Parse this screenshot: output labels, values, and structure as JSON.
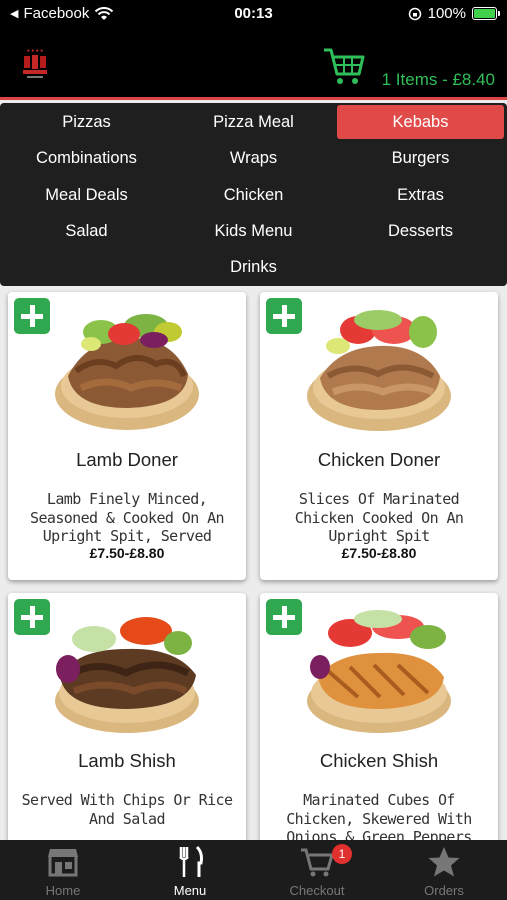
{
  "status_bar": {
    "back_app": "Facebook",
    "time": "00:13",
    "battery_percent": "100%",
    "battery_level": 1.0
  },
  "header": {
    "cart_summary": "1 Items - £8.40",
    "accent_color": "#2fbf5a"
  },
  "categories": {
    "items": [
      {
        "label": "Pizzas",
        "active": false
      },
      {
        "label": "Pizza Meal",
        "active": false
      },
      {
        "label": "Kebabs",
        "active": true
      },
      {
        "label": "Combinations",
        "active": false
      },
      {
        "label": "Wraps",
        "active": false
      },
      {
        "label": "Burgers",
        "active": false
      },
      {
        "label": "Meal Deals",
        "active": false
      },
      {
        "label": "Chicken",
        "active": false
      },
      {
        "label": "Extras",
        "active": false
      },
      {
        "label": "Salad",
        "active": false
      },
      {
        "label": "Kids Menu",
        "active": false
      },
      {
        "label": "Desserts",
        "active": false
      },
      {
        "label": "Drinks",
        "active": false
      }
    ],
    "active_color": "#e04a48"
  },
  "products": [
    {
      "name": "Lamb Doner",
      "description": "Lamb Finely Minced, Seasoned & Cooked On An Upright Spit, Served",
      "price": "£7.50-£8.80",
      "image_icon": "lamb-doner-image"
    },
    {
      "name": "Chicken Doner",
      "description": "Slices Of Marinated Chicken Cooked On An Upright Spit",
      "price": "£7.50-£8.80",
      "image_icon": "chicken-doner-image"
    },
    {
      "name": "Lamb Shish",
      "description": "Served With Chips Or Rice And Salad",
      "price": "",
      "image_icon": "lamb-shish-image"
    },
    {
      "name": "Chicken Shish",
      "description": "Marinated Cubes Of Chicken, Skewered With Onions & Green Peppers",
      "price": "",
      "image_icon": "chicken-shish-image"
    }
  ],
  "tabbar": {
    "tabs": [
      {
        "label": "Home",
        "icon": "store-icon",
        "active": false
      },
      {
        "label": "Menu",
        "icon": "fork-knife-icon",
        "active": true
      },
      {
        "label": "Checkout",
        "icon": "cart-icon",
        "active": false
      },
      {
        "label": "Orders",
        "icon": "star-icon",
        "active": false
      }
    ],
    "checkout_badge": "1",
    "badge_color": "#e0312f"
  }
}
